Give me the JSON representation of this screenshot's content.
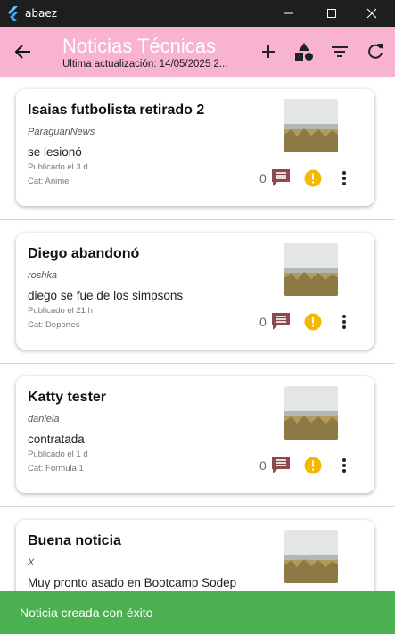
{
  "window": {
    "title": "abaez"
  },
  "appbar": {
    "title": "Noticias Técnicas",
    "subtitle": "Última actualización: 14/05/2025 2..."
  },
  "news": [
    {
      "title": "Isaias futbolista retirado 2",
      "source": "ParaguariNews",
      "description": "se lesionó",
      "published": "Publicado el 3 d",
      "category": "Cat: Anime",
      "comments": "0"
    },
    {
      "title": "Diego abandonó",
      "source": "roshka",
      "description": "diego se fue de los simpsons",
      "published": "Publicado el 21 h",
      "category": "Cat: Deportes",
      "comments": "0"
    },
    {
      "title": "Katty tester",
      "source": "daniela",
      "description": "contratada",
      "published": "Publicado el 1 d",
      "category": "Cat: Formula 1",
      "comments": "0"
    },
    {
      "title": "Buena noticia",
      "source": "X",
      "description": "Muy pronto asado en Bootcamp Sodep",
      "published": "",
      "category": "",
      "comments": ""
    }
  ],
  "snackbar": {
    "message": "Noticia creada con éxito"
  },
  "icons": {
    "comment": "comment-icon",
    "report": "report-icon",
    "more": "more-vert-icon"
  },
  "colors": {
    "appbar": "#f7b3cf",
    "comment": "#8d4a4a",
    "warning": "#f5b800",
    "snackbar": "#4caf50"
  }
}
